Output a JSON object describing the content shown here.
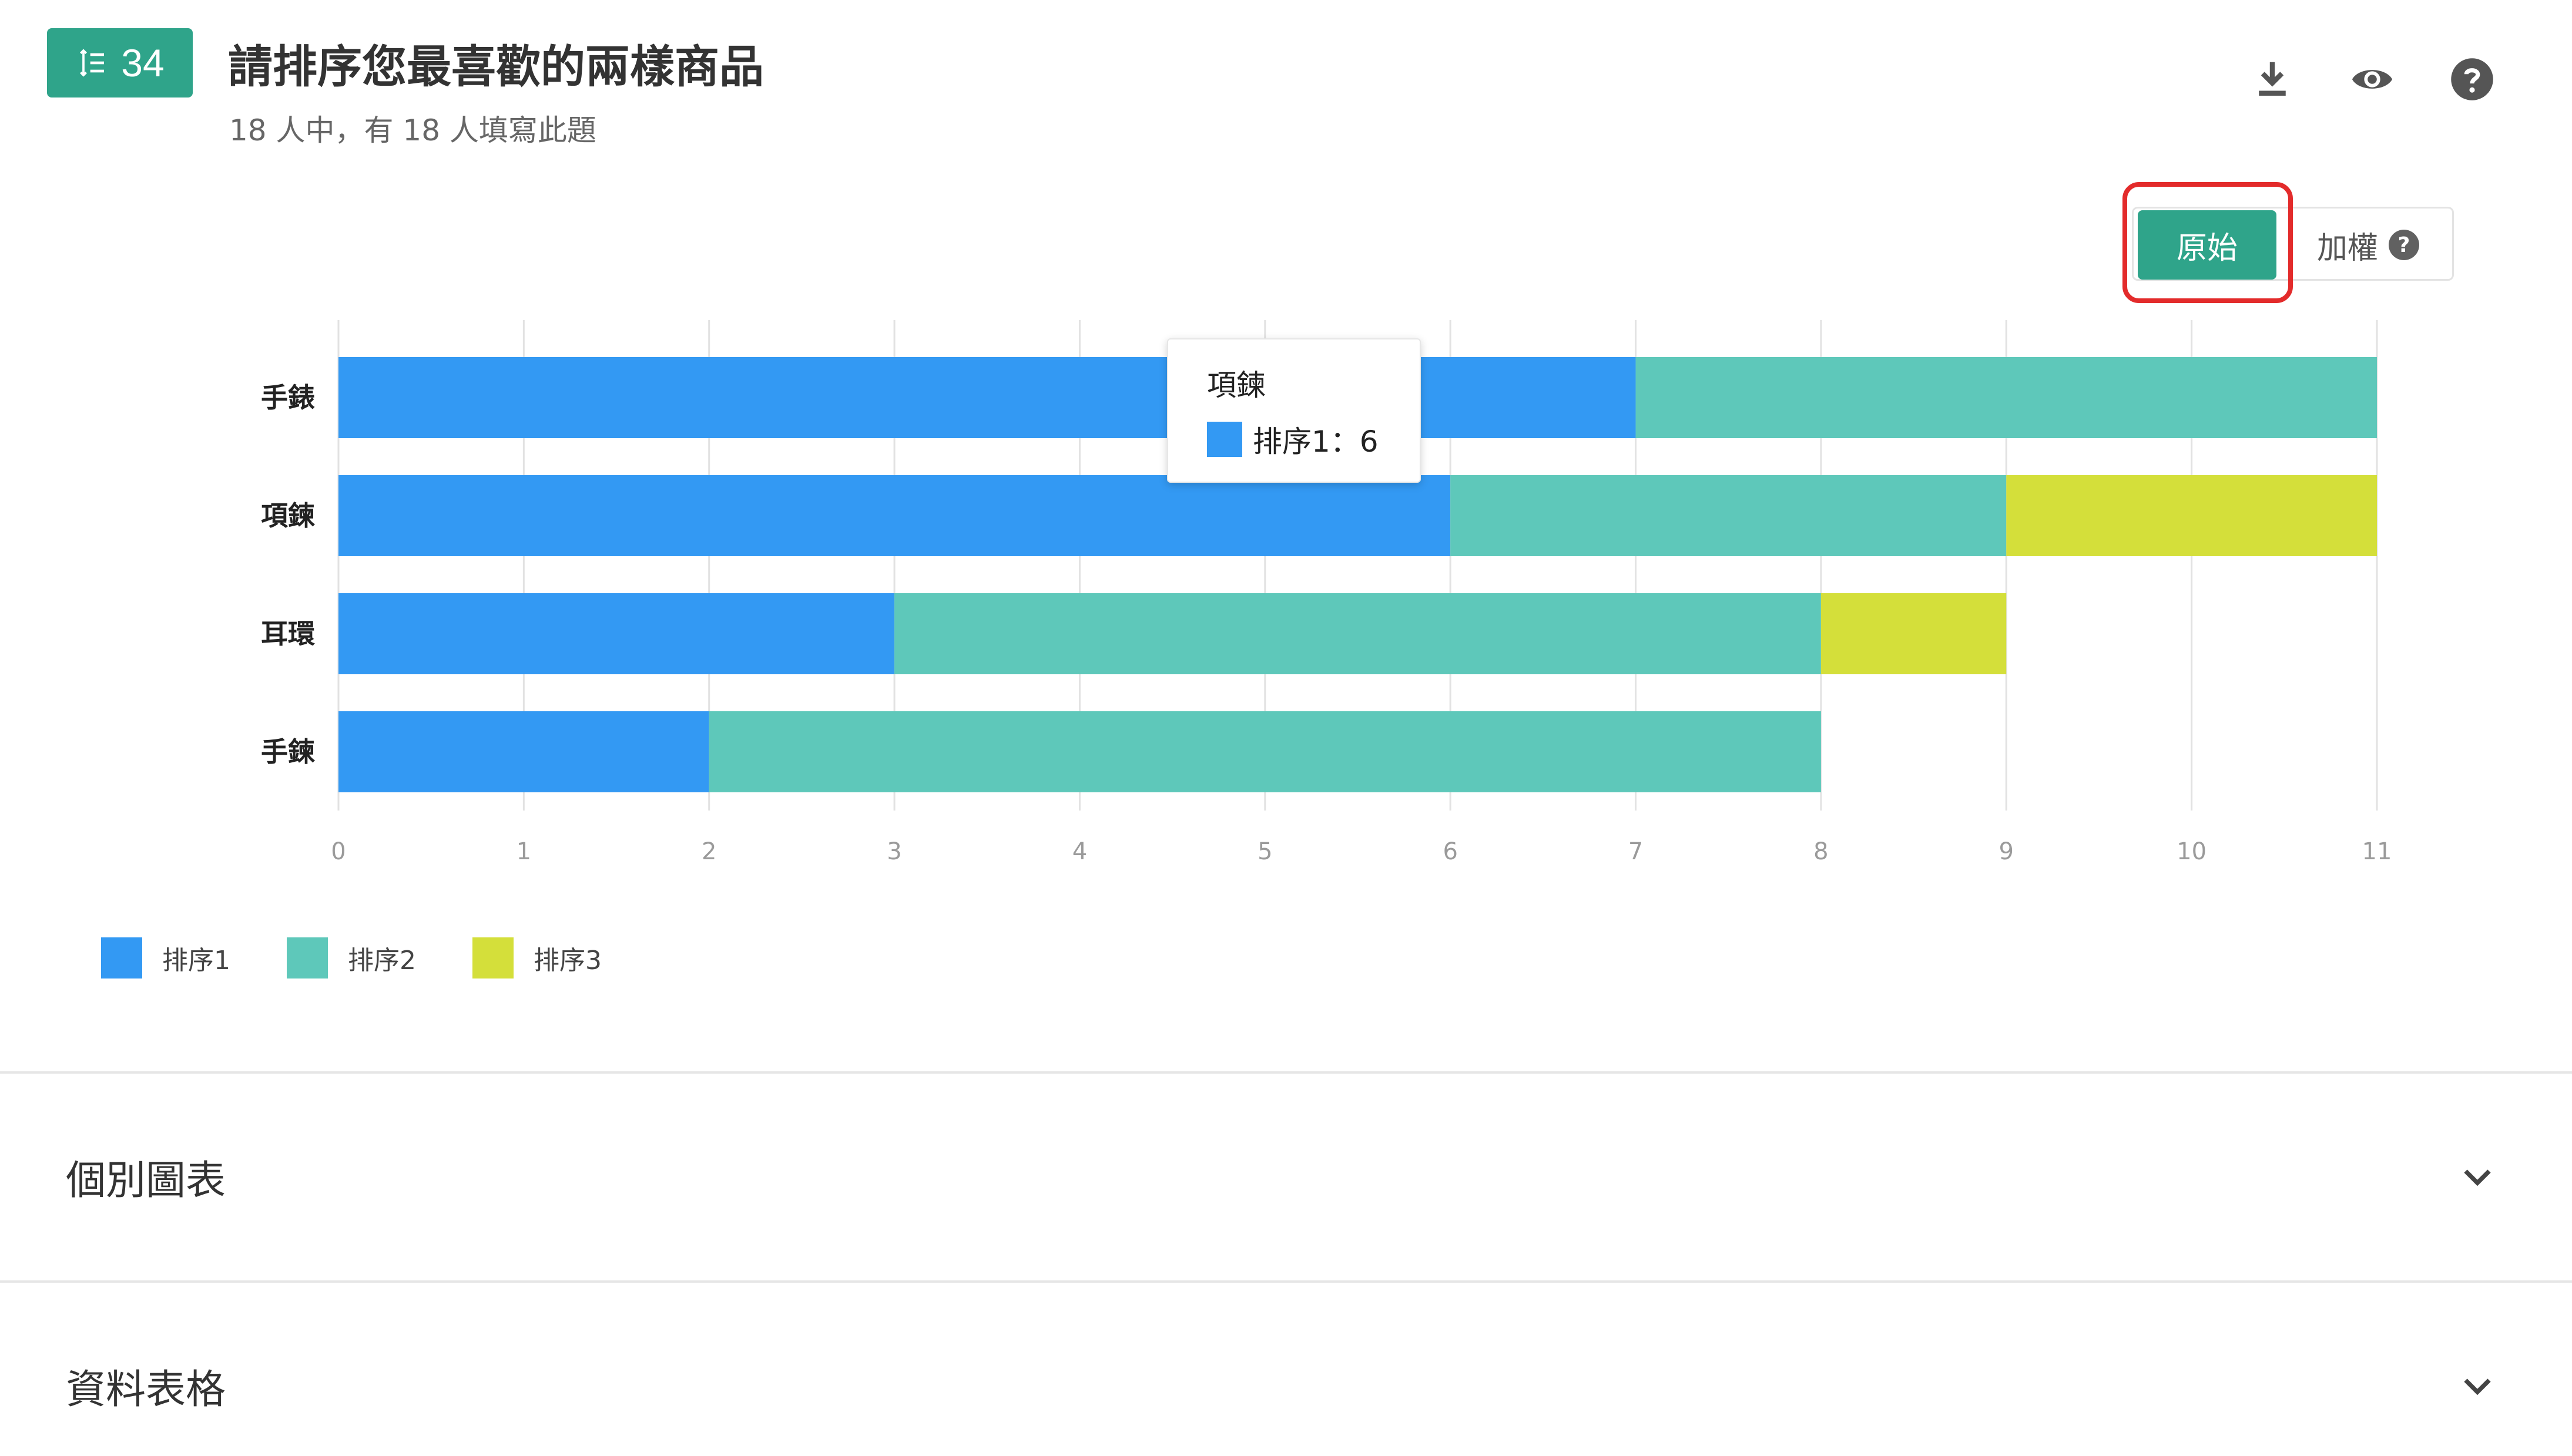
{
  "question": {
    "number": "34",
    "title": "請排序您最喜歡的兩樣商品",
    "subtitle": "18 人中，有 18 人填寫此題"
  },
  "toolbar": {
    "icons": [
      "download-icon",
      "eye-icon",
      "help-icon"
    ]
  },
  "toggle": {
    "raw_label": "原始",
    "weighted_label": "加權",
    "help_glyph": "?"
  },
  "colors": {
    "accent": "#2fa48a",
    "rank1": "#3399f3",
    "rank2": "#5ec8ba",
    "rank3": "#d4df3a",
    "highlight": "#e32b2b"
  },
  "chart_data": {
    "type": "bar",
    "orientation": "horizontal",
    "stacked": true,
    "categories": [
      "手錶",
      "項鍊",
      "耳環",
      "手鍊"
    ],
    "series": [
      {
        "name": "排序1",
        "values": [
          7,
          6,
          3,
          2
        ]
      },
      {
        "name": "排序2",
        "values": [
          4,
          3,
          5,
          6
        ]
      },
      {
        "name": "排序3",
        "values": [
          0,
          2,
          1,
          0
        ]
      }
    ],
    "xlim": [
      0,
      11
    ],
    "xticks": [
      "0",
      "1",
      "2",
      "3",
      "4",
      "5",
      "6",
      "7",
      "8",
      "9",
      "10",
      "11"
    ],
    "grid": true,
    "legend_position": "bottom-left"
  },
  "tooltip": {
    "title": "項鍊",
    "text": "排序1：6"
  },
  "sections": [
    {
      "title": "個別圖表"
    },
    {
      "title": "資料表格"
    }
  ]
}
